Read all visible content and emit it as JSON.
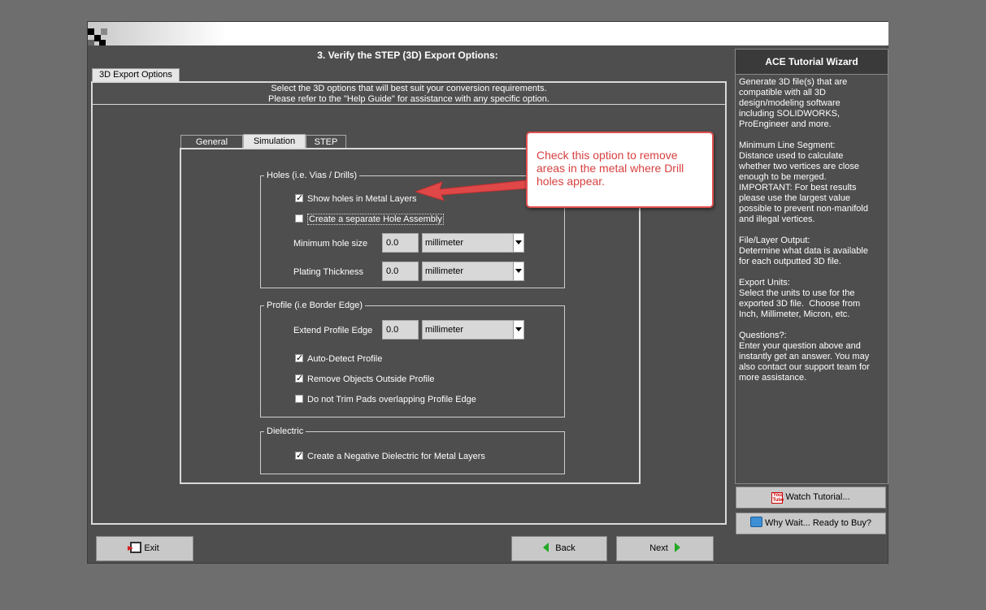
{
  "step_title": "3.  Verify the STEP (3D) Export Options:",
  "outer_tab": "3D Export Options",
  "intro": {
    "line1": "Select the 3D options that will best suit your conversion requirements.",
    "line2": "Please refer to the \"Help Guide\" for assistance with any specific option."
  },
  "tabs": [
    "General",
    "Simulation",
    "STEP"
  ],
  "active_tab": "Simulation",
  "holes": {
    "legend": "Holes (i.e. Vias / Drills)",
    "show_holes": {
      "label": "Show holes in Metal Layers",
      "checked": true
    },
    "separate_assembly": {
      "label": "Create a separate Hole Assembly",
      "checked": false
    },
    "min_hole": {
      "label": "Minimum hole size",
      "value": "0.0",
      "unit": "millimeter"
    },
    "plating": {
      "label": "Plating Thickness",
      "value": "0.0",
      "unit": "millimeter"
    }
  },
  "profile": {
    "legend": "Profile (i.e Border Edge)",
    "extend": {
      "label": "Extend Profile Edge",
      "value": "0.0",
      "unit": "millimeter"
    },
    "auto_detect": {
      "label": "Auto-Detect Profile",
      "checked": true
    },
    "remove_outside": {
      "label": "Remove Objects Outside Profile",
      "checked": true
    },
    "no_trim": {
      "label": "Do not Trim Pads overlapping Profile Edge",
      "checked": false
    }
  },
  "dielectric": {
    "legend": "Dielectric",
    "negative": {
      "label": "Create a Negative Dielectric for Metal Layers",
      "checked": true
    }
  },
  "side_panel": {
    "title": "ACE Tutorial Wizard",
    "text": "Generate 3D file(s) that are\ncompatible with all 3D\ndesign/modeling software\nincluding SOLIDWORKS,\nProEngineer and more.\n\nMinimum Line Segment:\nDistance used to calculate\nwhether two vertices are close\nenough to be merged.\nIMPORTANT: For best results\nplease use the largest value\npossible to prevent non-manifold\nand illegal vertices.\n\nFile/Layer Output:\nDetermine what data is available\nfor each outputted 3D file.\n\nExport Units:\nSelect the units to use for the\nexported 3D file.  Choose from\nInch, Millimeter, Micron, etc.\n\nQuestions?:\nEnter your question above and\ninstantly get an answer. You may\nalso contact our support team for\nmore assistance."
  },
  "buttons": {
    "watch": "Watch Tutorial...",
    "buy": "Why Wait... Ready to Buy?",
    "exit": "Exit",
    "back": "Back",
    "next": "Next"
  },
  "callout": "Check this option to remove areas in the metal where Drill holes appear.",
  "colors": {
    "callout_border": "#e05050",
    "callout_text": "#d84040",
    "arrow": "#e04848",
    "nav_arrow": "#22aa22"
  }
}
